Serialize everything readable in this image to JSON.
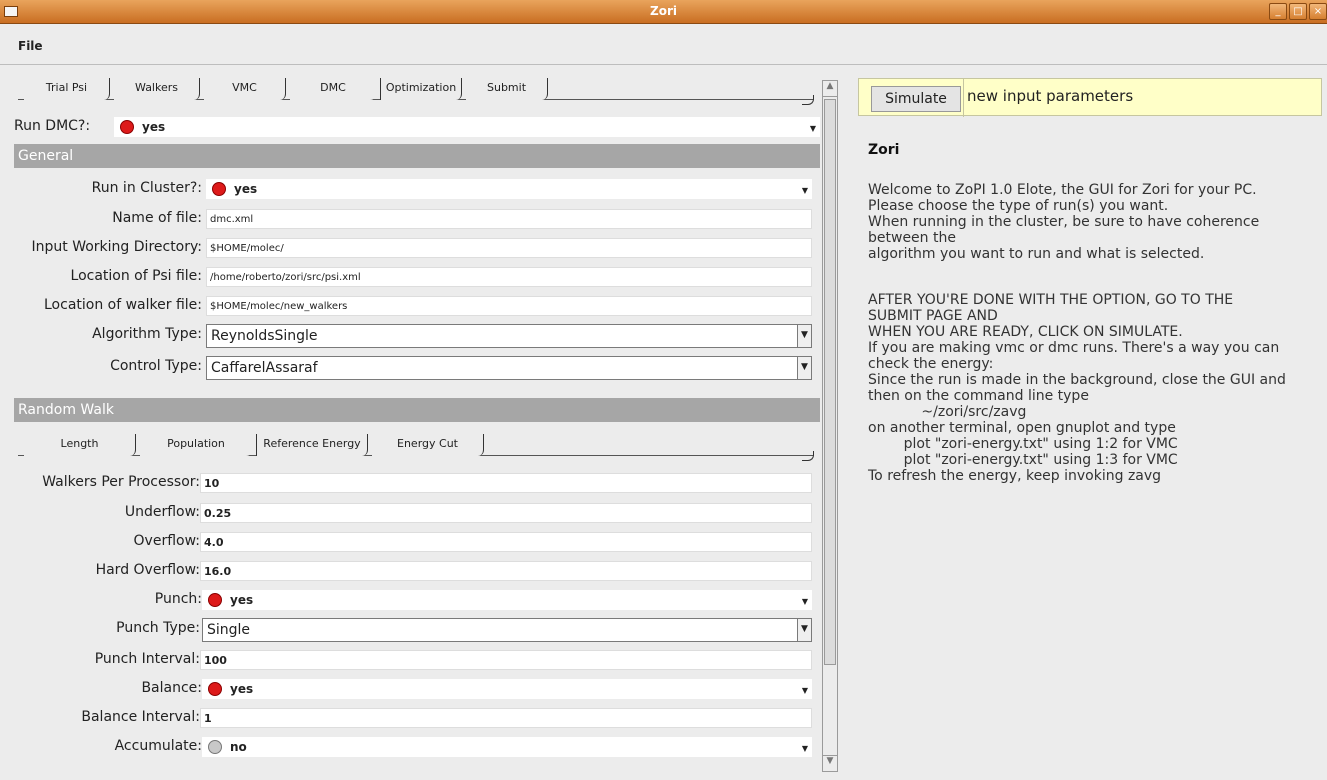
{
  "window": {
    "title": "Zori"
  },
  "menu": {
    "file": "File"
  },
  "main_tabs": [
    "Trial Psi",
    "Walkers",
    "VMC",
    "DMC",
    "Optimization",
    "Submit"
  ],
  "run_dmc": {
    "label": "Run DMC?:",
    "value": "yes"
  },
  "general": {
    "header": "General",
    "run_in_cluster": {
      "label": "Run in Cluster?:",
      "value": "yes"
    },
    "name_of_file": {
      "label": "Name of file:",
      "value": "dmc.xml"
    },
    "input_dir": {
      "label": "Input Working Directory:",
      "value": "$HOME/molec/"
    },
    "psi_file": {
      "label": "Location of Psi file:",
      "value": "/home/roberto/zori/src/psi.xml"
    },
    "walker_file": {
      "label": "Location of walker file:",
      "value": "$HOME/molec/new_walkers"
    },
    "algorithm_type": {
      "label": "Algorithm Type:",
      "value": "ReynoldsSingle"
    },
    "control_type": {
      "label": "Control Type:",
      "value": "CaffarelAssaraf"
    }
  },
  "random_walk": {
    "header": "Random Walk",
    "tabs": [
      "Length",
      "Population",
      "Reference Energy",
      "Energy Cut"
    ],
    "walkers_per_processor": {
      "label": "Walkers Per Processor:",
      "value": "10"
    },
    "underflow": {
      "label": "Underflow:",
      "value": "0.25"
    },
    "overflow": {
      "label": "Overflow:",
      "value": "4.0"
    },
    "hard_overflow": {
      "label": "Hard Overflow:",
      "value": "16.0"
    },
    "punch": {
      "label": "Punch:",
      "value": "yes"
    },
    "punch_type": {
      "label": "Punch Type:",
      "value": "Single"
    },
    "punch_interval": {
      "label": "Punch Interval:",
      "value": "100"
    },
    "balance": {
      "label": "Balance:",
      "value": "yes"
    },
    "balance_interval": {
      "label": "Balance Interval:",
      "value": "1"
    },
    "accumulate": {
      "label": "Accumulate:",
      "value": "no"
    }
  },
  "right": {
    "simulate_button": "Simulate",
    "status": "new input parameters",
    "heading": "Zori",
    "lines": [
      "Welcome to ZoPI 1.0 Elote, the GUI for Zori for your PC.",
      "Please choose the type of run(s) you want.",
      "When running in the cluster, be sure to have coherence",
      "between the",
      "algorithm you want to run and what is selected.",
      "",
      "AFTER YOU'RE DONE WITH THE OPTION, GO TO THE",
      "SUBMIT PAGE AND",
      "WHEN YOU ARE READY, CLICK ON SIMULATE.",
      "If you are making vmc or dmc runs. There's a way you can",
      "check the energy:",
      "Since the run is made in the background, close the GUI and",
      "then on the command line type",
      "            ~/zori/src/zavg",
      "on another terminal, open gnuplot and type",
      "        plot \"zori-energy.txt\" using 1:2 for VMC",
      "        plot \"zori-energy.txt\" using 1:3 for VMC",
      "To refresh the energy, keep invoking zavg"
    ]
  }
}
